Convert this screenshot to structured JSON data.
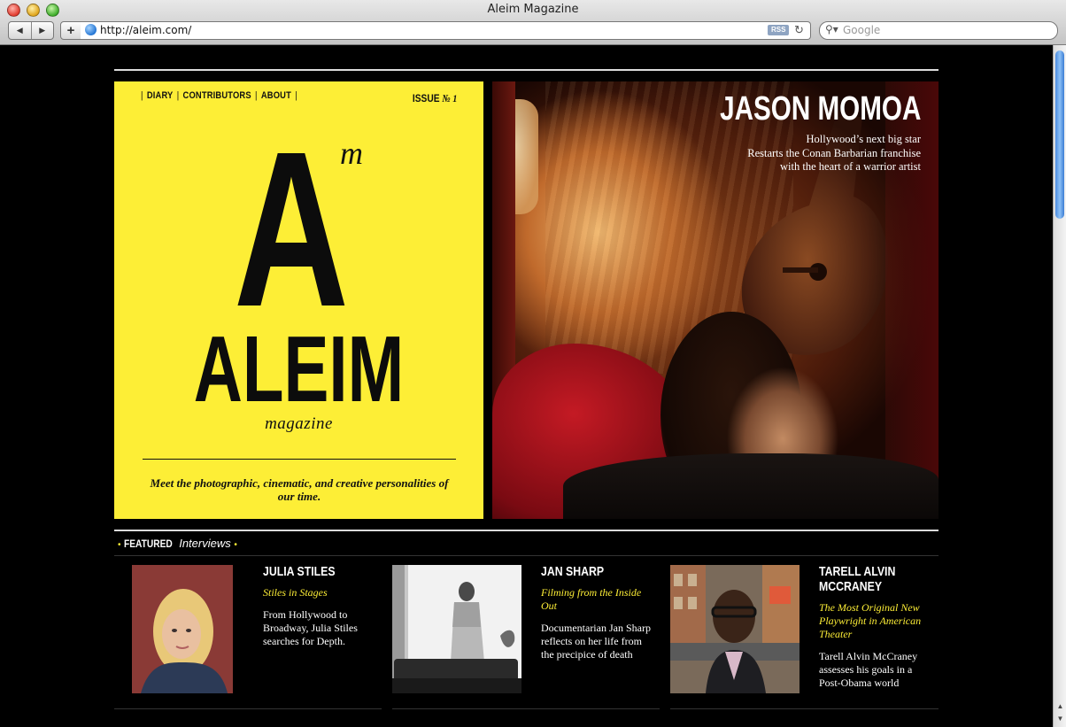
{
  "window": {
    "title": "Aleim Magazine",
    "url": "http://aleim.com/",
    "rss_label": "RSS",
    "search_placeholder": "Google"
  },
  "cover": {
    "nav": [
      "DIARY",
      "CONTRIBUTORS",
      "ABOUT"
    ],
    "issue_label": "ISSUE",
    "issue_number": "№ 1",
    "logo_letter": "A",
    "logo_super": "m",
    "brand": "ALEIM",
    "sub": "magazine",
    "tagline": "Meet the photographic, cinematic, and creative personalities of our time."
  },
  "hero": {
    "name": "JASON MOMOA",
    "desc": [
      "Hollywood’s next big star",
      "Restarts the Conan Barbarian franchise",
      "with the heart of a warrior artist"
    ]
  },
  "featured": {
    "label_bold": "FEATURED",
    "label_italic": "Interviews",
    "items": [
      {
        "name": "JULIA STILES",
        "subtitle": "Stiles in Stages",
        "desc": "From Hollywood to Broadway, Julia Stiles searches for Depth."
      },
      {
        "name": "JAN SHARP",
        "subtitle": "Filming from the Inside Out",
        "desc": "Documentarian Jan Sharp reflects on her life from the precipice of death"
      },
      {
        "name": "TARELL ALVIN MCCRANEY",
        "subtitle": "The Most Original New Playwright in American Theater",
        "desc": "Tarell Alvin McCraney assesses his goals in a Post-Obama world"
      }
    ]
  },
  "colors": {
    "accent_yellow": "#fdee36",
    "page_background": "#000000"
  },
  "icons": [
    "back-icon",
    "forward-icon",
    "add-bookmark-icon",
    "globe-icon",
    "rss-icon",
    "reload-icon",
    "search-icon"
  ]
}
